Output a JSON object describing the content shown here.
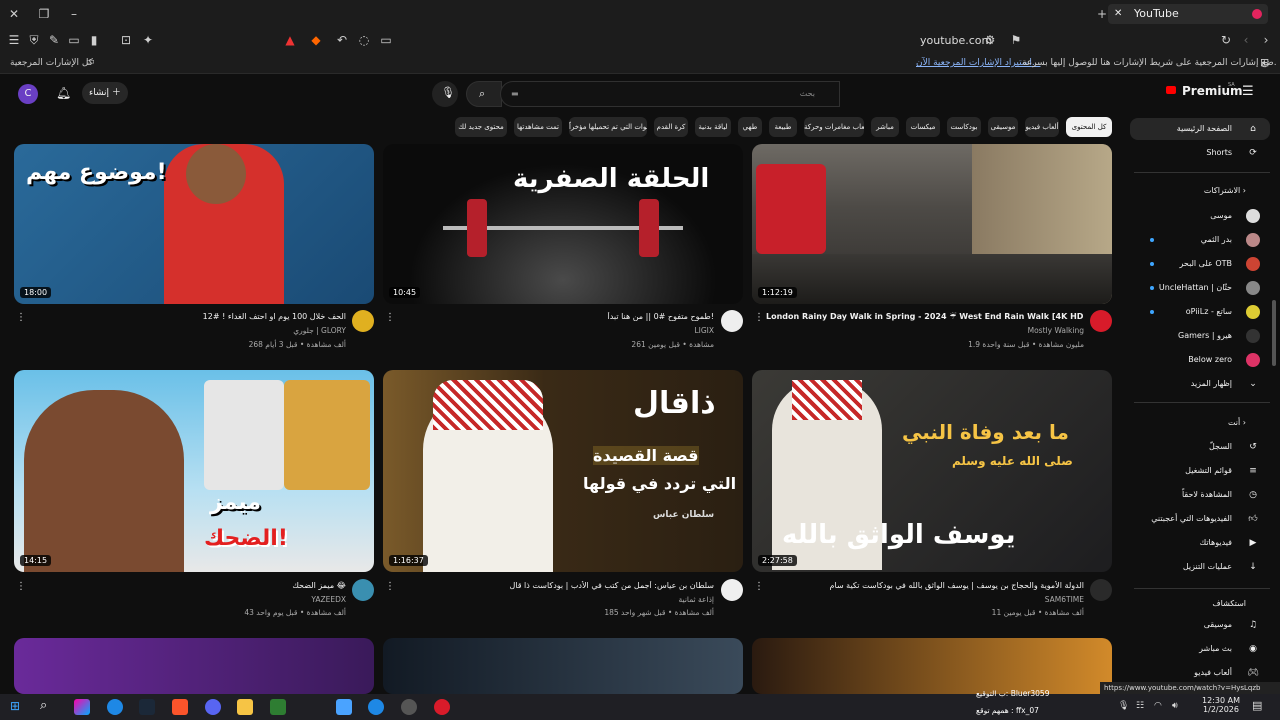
{
  "browser": {
    "tab_title": "YouTube",
    "url": "youtube.com",
    "bookmarks_hint": "ضع إشارات المرجعية على شريط الإشارات هنا للوصول إليها بسرعة.",
    "bookmarks_import": "استيراد الإشارات المرجعية الآن...",
    "all_bookmarks": "كل الإشارات المرجعية",
    "shield_count": "51"
  },
  "header": {
    "logo": "Premium",
    "logo_sup": "SA",
    "search_placeholder": "بحث",
    "create_label": "إنشاء",
    "avatar_letter": "C"
  },
  "chips": [
    "كل المحتوى",
    "ألعاب فيديو",
    "موسيقى",
    "بودكاست",
    "ميكسات",
    "مباشر",
    "ألعاب مغامرات وحركة",
    "طبيعة",
    "طهي",
    "لياقة بدنية",
    "كرة القدم",
    "الفنوات التي تم تحميلها مؤخراً",
    "تمت مشاهدتها",
    "محتوى جديد لك"
  ],
  "sidebar": {
    "home": "الصفحة الرئيسية",
    "shorts": "Shorts",
    "subscriptions_head": "الاشتراكات",
    "subs": [
      "موسى",
      "بدر الثمي",
      "على البحر OTB",
      "UncleHattan | حتّان",
      "oPiiLz - ساتع",
      "Gamers | هيرو",
      "Below zero"
    ],
    "show_more": "إظهار المزيد",
    "you_head": "أنت",
    "you_items": [
      "السجلّ",
      "قوائم التشغيل",
      "المشاهدة لاحقاً",
      "الفيديوهات التي أعجبتني",
      "فيديوهاتك",
      "عمليات التنزيل"
    ],
    "explore_head": "استكشاف",
    "explore_items": [
      "موسيقى",
      "بث مباشر",
      "ألعاب فيديو"
    ]
  },
  "videos": [
    {
      "title": "London Rainy Day Walk in Spring - 2024 ☔ West End Rain Walk [4K HDR]",
      "channel": "Mostly Walking",
      "meta": "1.9 مليون مشاهدة • قبل سنة واحدة",
      "duration": "1:12:19"
    },
    {
      "title": "طموح متفوح #0 || من هنا تبدأ!",
      "channel": "LIGIX",
      "meta": "261 مشاهدة • قبل يومين",
      "duration": "10:45",
      "art": "الحلقة الصفرية"
    },
    {
      "title": "الحف خلال 100 يوم او احتف الغداء ! #12",
      "channel": "جلوري | GLORY",
      "meta": "268 ألف مشاهدة • قبل 3 أيام",
      "duration": "18:00",
      "art": "موضوع مهم!"
    },
    {
      "title": "الدولة الأموية والحجاج بن يوسف | يوسف الواثق بالله في بودكاست تكية سام",
      "channel": "SAM6TIME",
      "meta": "11 ألف مشاهدة • قبل يومين",
      "duration": "2:27:58",
      "art": "ما بعد وفاة النبي",
      "art2": "صلى الله عليه وسلم",
      "art3": "يوسف الواثق بالله"
    },
    {
      "title": "سلطان بن عياس: أجمل من كتب في الأدب | بودكاست ذا قال",
      "channel": "إذاعة ثمانية",
      "meta": "185 ألف مشاهدة • قبل شهر واحد",
      "duration": "1:16:37",
      "art": "ذاقال",
      "art2": "قصة القصيدة",
      "art3": "التي تردد في قولها",
      "art4": "سلطان عباس"
    },
    {
      "title": "ميمز الضحك 😂",
      "channel": "YAZEEDX",
      "meta": "43 ألف مشاهدة • قبل يوم واحد",
      "duration": "14:15",
      "art": "ميمز",
      "art2": "الضحك!"
    }
  ],
  "taskbar": {
    "time": "12:30 AM",
    "date": "1/2/2026",
    "status_url": "https://www.youtube.com/watch?v=HysLqzb",
    "notif1": "ب التوقيع: Bluer3059",
    "notif2": "همهم توقع : ffx_07"
  }
}
